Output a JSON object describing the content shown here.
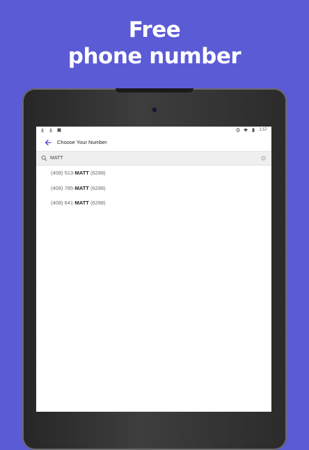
{
  "headline": {
    "line1": "Free",
    "line2": "phone number"
  },
  "statusbar": {
    "time": "1:57"
  },
  "appbar": {
    "title": "Choose Your Number"
  },
  "search": {
    "value": "MATT"
  },
  "results": [
    {
      "prefix": "(408) 513-",
      "match": "MATT",
      "suffix": " (6288)"
    },
    {
      "prefix": "(408) 785-",
      "match": "MATT",
      "suffix": " (6288)"
    },
    {
      "prefix": "(408) 641-",
      "match": "MATT",
      "suffix": " (6288)"
    }
  ],
  "colors": {
    "background": "#5b5bd6",
    "accent": "#4a46c9",
    "text": "#222222"
  }
}
